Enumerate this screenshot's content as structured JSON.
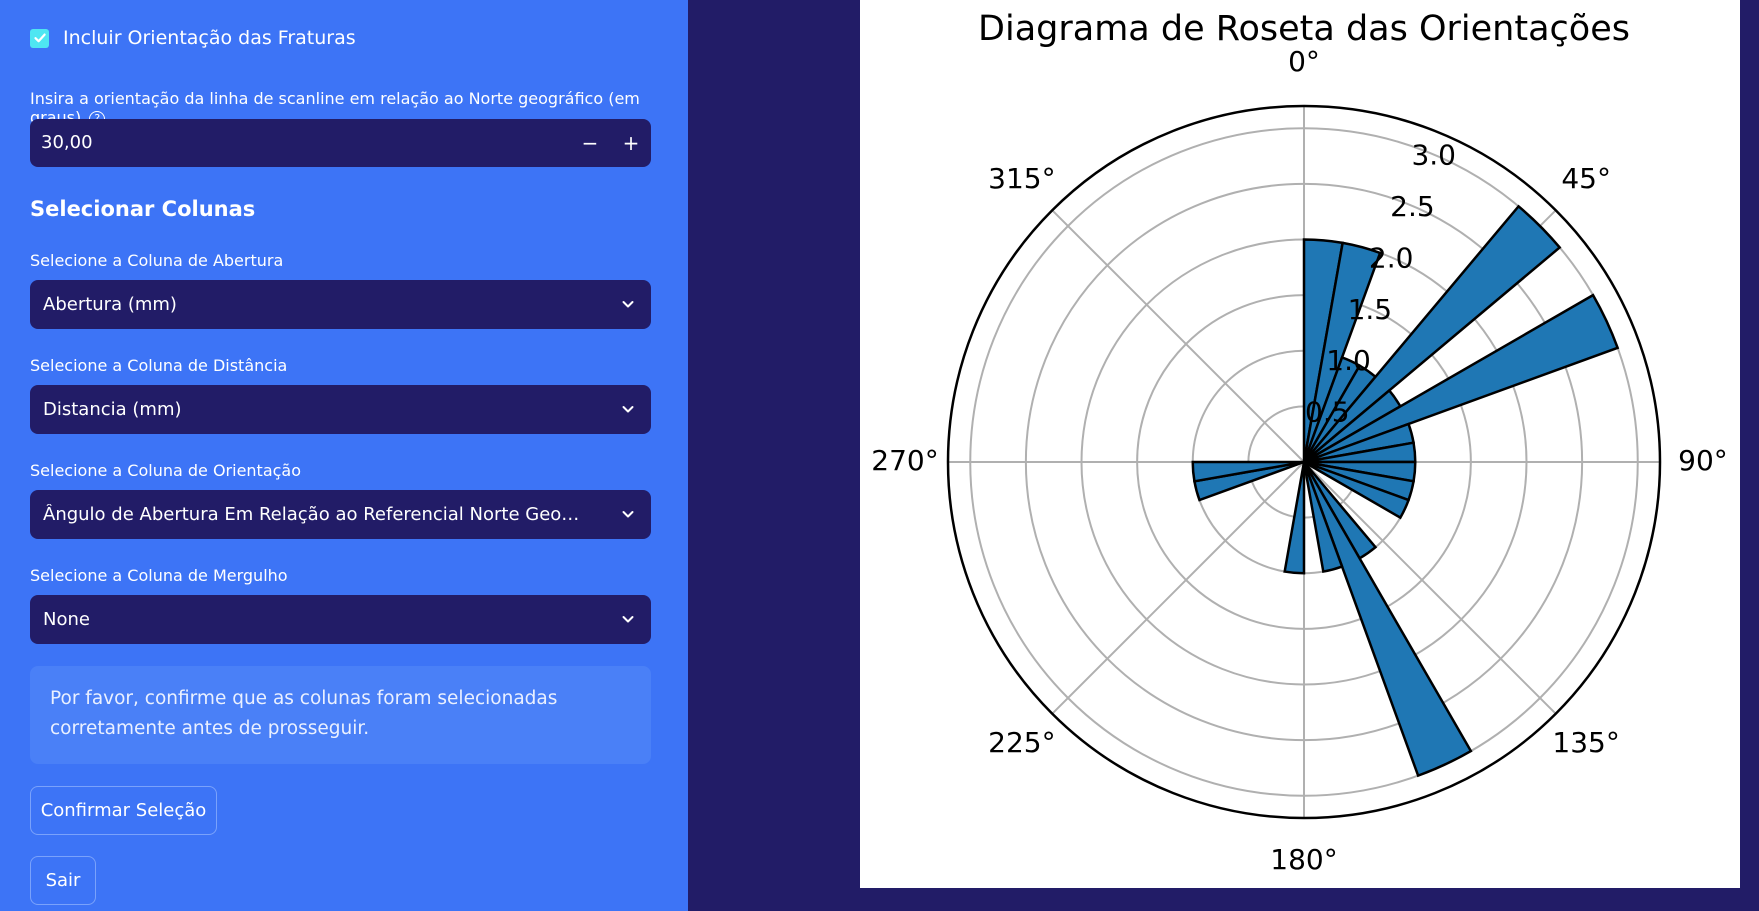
{
  "sidebar": {
    "checkbox_label": "Incluir Orientação das Fraturas",
    "checkbox_checked": true,
    "scanline_label": "Insira a orientação da linha de scanline em relação ao Norte geográfico (em graus)",
    "scanline_value": "30,00",
    "minus": "−",
    "plus": "+",
    "help_glyph": "?",
    "section_title": "Selecionar Colunas",
    "abertura_label": "Selecione a Coluna de Abertura",
    "abertura_value": "Abertura (mm)",
    "distancia_label": "Selecione a Coluna de Distância",
    "distancia_value": "Distancia (mm)",
    "orientacao_label": "Selecione a Coluna de Orientação",
    "orientacao_value": "Ângulo de Abertura Em Relação ao Referencial Norte Geografico (graus)",
    "mergulho_label": "Selecione a Coluna de Mergulho",
    "mergulho_value": "None",
    "info_text": "Por favor, confirme que as colunas foram selecionadas corretamente antes de prosseguir.",
    "confirm_button": "Confirmar Seleção",
    "exit_button": "Sair"
  },
  "colors": {
    "sidebar_bg": "#3d74f6",
    "main_bg": "#221c67",
    "input_bg": "#221c67",
    "checkbox": "#4ee6f2",
    "bar_fill": "#1f77b4"
  },
  "chart_data": {
    "type": "rose",
    "title": "Diagrama de Roseta das Orientações",
    "bin_width_deg": 10,
    "theta_direction": "clockwise",
    "theta_zero": "N",
    "angle_ticks": [
      "0°",
      "45°",
      "90°",
      "135°",
      "180°",
      "225°",
      "270°",
      "315°"
    ],
    "radial_ticks": [
      "0.5",
      "1.0",
      "1.5",
      "2.0",
      "2.5",
      "3.0"
    ],
    "rmax": 3.2,
    "grid": true,
    "bins": [
      {
        "start": 0,
        "end": 10,
        "value": 2
      },
      {
        "start": 10,
        "end": 20,
        "value": 2
      },
      {
        "start": 20,
        "end": 30,
        "value": 1
      },
      {
        "start": 30,
        "end": 40,
        "value": 1
      },
      {
        "start": 40,
        "end": 50,
        "value": 3
      },
      {
        "start": 50,
        "end": 60,
        "value": 1
      },
      {
        "start": 60,
        "end": 70,
        "value": 3
      },
      {
        "start": 70,
        "end": 80,
        "value": 1
      },
      {
        "start": 80,
        "end": 90,
        "value": 1
      },
      {
        "start": 90,
        "end": 100,
        "value": 1
      },
      {
        "start": 100,
        "end": 110,
        "value": 1
      },
      {
        "start": 110,
        "end": 120,
        "value": 1
      },
      {
        "start": 140,
        "end": 150,
        "value": 1
      },
      {
        "start": 150,
        "end": 160,
        "value": 3
      },
      {
        "start": 160,
        "end": 170,
        "value": 1
      },
      {
        "start": 180,
        "end": 190,
        "value": 1
      },
      {
        "start": 250,
        "end": 260,
        "value": 1
      },
      {
        "start": 260,
        "end": 270,
        "value": 1
      }
    ]
  }
}
